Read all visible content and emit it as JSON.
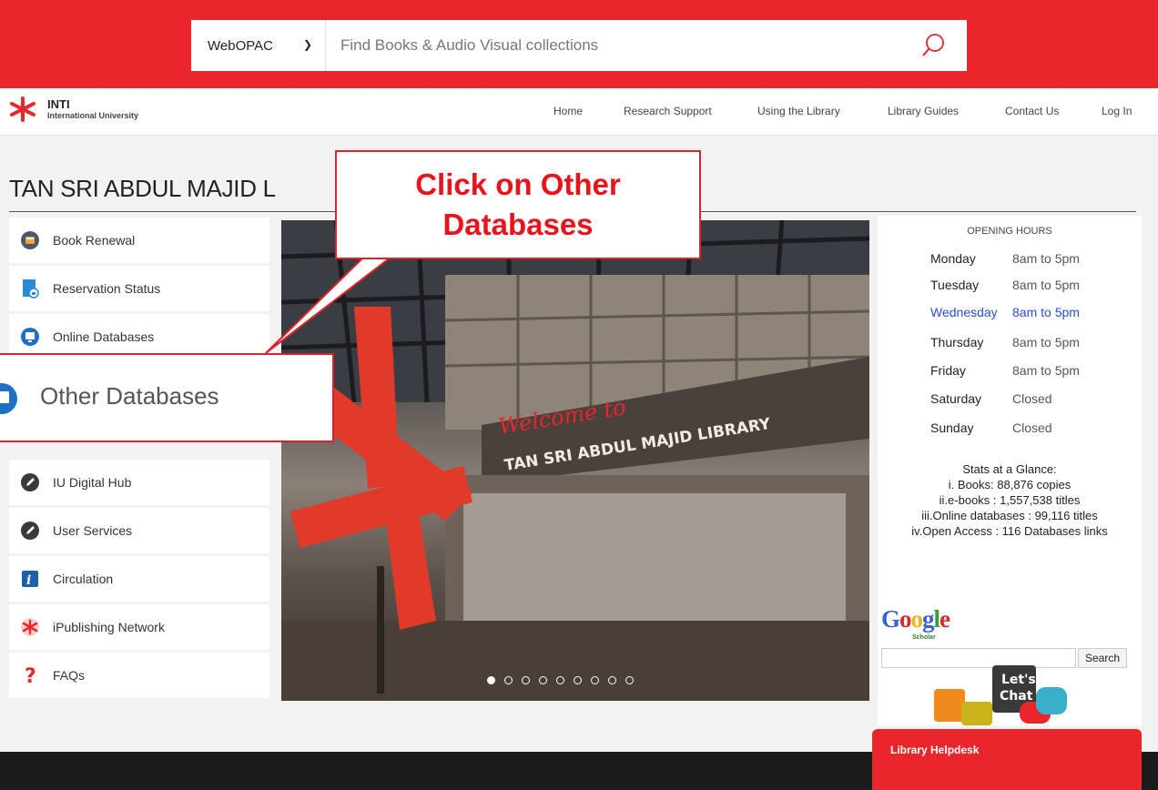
{
  "search": {
    "scope": "WebOPAC",
    "placeholder": "Find Books & Audio Visual collections"
  },
  "logo": {
    "line1": "INTI",
    "line2": "International University"
  },
  "nav": {
    "items": [
      "Home",
      "Research Support",
      "Using the Library",
      "Library Guides",
      "Contact Us",
      "Log In"
    ]
  },
  "page_title": "TAN SRI ABDUL MAJID L",
  "sidebar": {
    "items": [
      {
        "label": "Book Renewal",
        "icon": "book-icon"
      },
      {
        "label": "Reservation Status",
        "icon": "document-lock-icon"
      },
      {
        "label": "Online Databases",
        "icon": "database-icon"
      },
      {
        "label": "IU Digital Hub",
        "icon": "edit-icon"
      },
      {
        "label": "User Services",
        "icon": "edit-icon"
      },
      {
        "label": "Circulation",
        "icon": "info-icon"
      },
      {
        "label": "iPublishing Network",
        "icon": "network-icon"
      },
      {
        "label": "FAQs",
        "icon": "question-icon"
      }
    ]
  },
  "slider": {
    "welcome": "Welcome to",
    "sign": "TAN SRI ABDUL MAJID LIBRARY",
    "dot_count": 9,
    "active_dot": 0
  },
  "opening_hours": {
    "title": "OPENING HOURS",
    "rows": [
      {
        "day": "Monday",
        "time": "8am to 5pm"
      },
      {
        "day": "Tuesday",
        "time": "8am to 5pm"
      },
      {
        "day": "Wednesday",
        "time": "8am to 5pm"
      },
      {
        "day": "Thursday",
        "time": "8am to 5pm"
      },
      {
        "day": "Friday",
        "time": "8am to 5pm"
      },
      {
        "day": "Saturday",
        "time": "Closed"
      },
      {
        "day": "Sunday",
        "time": "Closed"
      }
    ],
    "highlight_color": "#2a4fd0"
  },
  "stats": {
    "title": "Stats at a Glance:",
    "lines": [
      "i. Books: 88,876 copies",
      "ii.e-books : 1,557,538 titles",
      "iii.Online databases : 99,116 titles",
      "iv.Open Access : 116 Databases links"
    ]
  },
  "google_scholar": {
    "logo": "Google",
    "sub": "Scholar",
    "search_label": "Search"
  },
  "chat": {
    "line1": "Let's",
    "line2": "Chat"
  },
  "helpdesk": {
    "label": "Library Helpdesk"
  },
  "callout": {
    "text": "Click on Other Databases",
    "zoom_label": "Other Databases"
  },
  "colors": {
    "brand_red": "#e8262c",
    "callout_red": "#e8141c",
    "footer": "#1b1b1b"
  }
}
